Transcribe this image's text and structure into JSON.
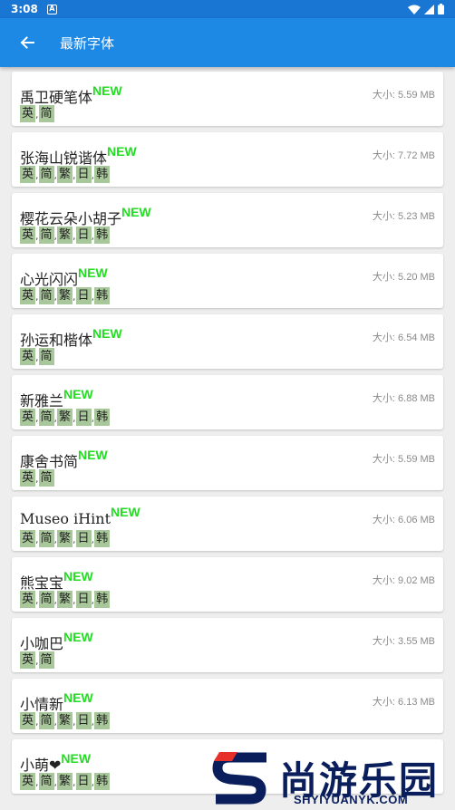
{
  "status_bar": {
    "time": "3:08",
    "notif_icon_letter": "A"
  },
  "app_bar": {
    "title": "最新字体"
  },
  "new_label": "NEW",
  "fonts": [
    {
      "name": "禹卫硬笔体",
      "size": "大小: 5.59 MB",
      "tags": [
        "英",
        "简"
      ]
    },
    {
      "name": "张海山锐谐体",
      "size": "大小: 7.72 MB",
      "tags": [
        "英",
        "简",
        "繁",
        "日",
        "韩"
      ]
    },
    {
      "name": "樱花云朵小胡子",
      "size": "大小: 5.23 MB",
      "tags": [
        "英",
        "简",
        "繁",
        "日",
        "韩"
      ]
    },
    {
      "name": "心光闪闪",
      "size": "大小: 5.20 MB",
      "tags": [
        "英",
        "简",
        "繁",
        "日",
        "韩"
      ]
    },
    {
      "name": "孙运和楷体",
      "size": "大小: 6.54 MB",
      "tags": [
        "英",
        "简"
      ]
    },
    {
      "name": "新雅兰",
      "size": "大小: 6.88 MB",
      "tags": [
        "英",
        "简",
        "繁",
        "日",
        "韩"
      ]
    },
    {
      "name": "康舍书简",
      "size": "大小: 5.59 MB",
      "tags": [
        "英",
        "简"
      ]
    },
    {
      "name": "Museo iHint",
      "size": "大小: 6.06 MB",
      "tags": [
        "英",
        "简",
        "繁",
        "日",
        "韩"
      ]
    },
    {
      "name": "熊宝宝",
      "size": "大小: 9.02 MB",
      "tags": [
        "英",
        "简",
        "繁",
        "日",
        "韩"
      ]
    },
    {
      "name": "小咖巴",
      "size": "大小: 3.55 MB",
      "tags": [
        "英",
        "简"
      ]
    },
    {
      "name": "小情新",
      "size": "大小: 6.13 MB",
      "tags": [
        "英",
        "简",
        "繁",
        "日",
        "韩"
      ]
    },
    {
      "name": "小萌❤",
      "size": "",
      "tags": [
        "英",
        "简",
        "繁",
        "日",
        "韩"
      ]
    }
  ],
  "watermark": {
    "text": "尚游乐园",
    "url": "SHYIYUANYK.COM",
    "brand_color": "#0a1e5c",
    "accent_color": "#e8302a"
  },
  "colors": {
    "app_bar": "#1e88e5",
    "status_bar": "#1976d2",
    "new_badge": "#22dd22",
    "tag_bg": "#a8c79a"
  }
}
